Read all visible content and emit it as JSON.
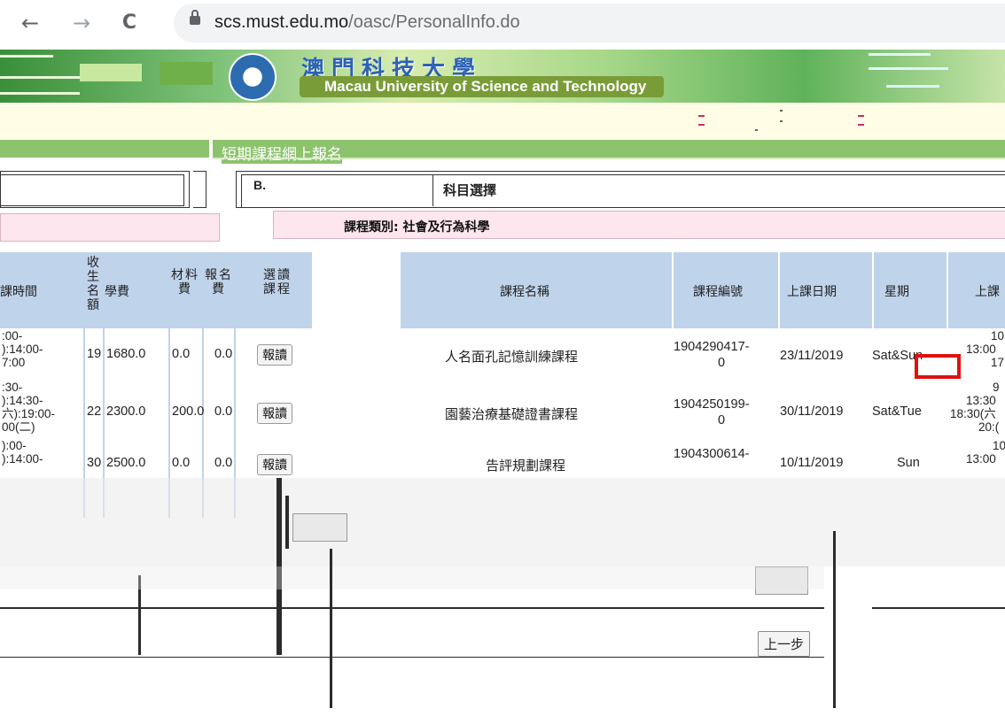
{
  "browser": {
    "back_icon": "←",
    "forward_icon": "→",
    "reload_icon": "C",
    "url_host": "scs.must.edu.mo",
    "url_path": "/oasc/PersonalInfo.do"
  },
  "banner": {
    "university_en": "Macau University of Science and Technology"
  },
  "page": {
    "title": "短期課程網上報名",
    "section_letter": "B.",
    "section_title": "科目選擇",
    "category": "課程類別: 社會及行為科學",
    "prev_button": "上一步"
  },
  "left_table": {
    "headers": {
      "time": "課時間",
      "quota": "收生名額",
      "tuition": "學費",
      "material": "材料費",
      "registration": "報名費",
      "select": "選讀課程"
    },
    "rows": [
      {
        "time": [
          ":00-",
          "):14:00-",
          "7:00"
        ],
        "quota": "19",
        "tuition": "1680.0",
        "material": "0.0",
        "reg": "0.0",
        "button": "報讀"
      },
      {
        "time": [
          ":30-",
          "):14:30-",
          "六):19:00-",
          "00(二)"
        ],
        "quota": "22",
        "tuition": "2300.0",
        "material": "200.0",
        "reg": "0.0",
        "button": "報讀"
      },
      {
        "time": [
          "):00-",
          "):14:00-"
        ],
        "quota": "30",
        "tuition": "2500.0",
        "material": "0.0",
        "reg": "0.0",
        "button": "報讀"
      }
    ]
  },
  "right_table": {
    "headers": {
      "name": "課程名稱",
      "code": "課程編號",
      "date": "上課日期",
      "weekday": "星期",
      "time": "上課"
    },
    "rows": [
      {
        "name": "人名面孔記憶訓練課程",
        "code1": "1904290417-",
        "code2": "0",
        "date": "23/11/2019",
        "weekday": "Sat&Sun",
        "time": [
          "10",
          "13:00",
          "17"
        ]
      },
      {
        "name": "園藝治療基礎證書課程",
        "code1": "1904250199-",
        "code2": "0",
        "date": "30/11/2019",
        "weekday": "Sat&Tue",
        "time": [
          "9",
          "13:30",
          "18:30(六",
          "20:("
        ]
      },
      {
        "name": "告評規劃課程",
        "code1": "1904300614-",
        "code2": "",
        "date": "10/11/2019",
        "weekday": "Sun",
        "time": [
          "10",
          "13:00"
        ]
      }
    ]
  },
  "colors": {
    "header_blue": "#bfd3ea",
    "green_bar": "#8cc36c",
    "cream": "#fffde5",
    "pink": "#fde6ee",
    "highlight_red": "#e01010"
  }
}
